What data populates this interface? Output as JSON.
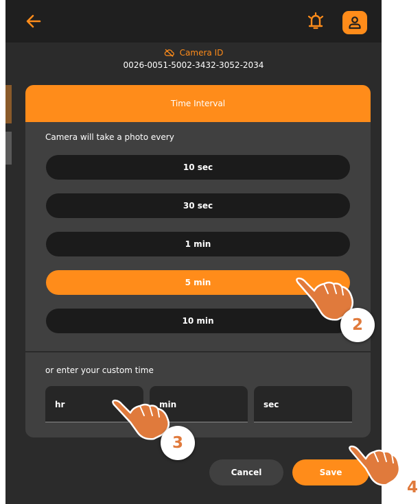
{
  "header": {
    "back_icon": "arrow-left-icon",
    "alarm_icon": "alarm-bell-icon",
    "profile_icon": "user-icon"
  },
  "camera": {
    "label": "Camera ID",
    "status_icon": "cloud-off-icon",
    "id": "0026-0051-5002-3432-3052-2034"
  },
  "dialog": {
    "title": "Time Interval",
    "prompt": "Camera will take a photo every",
    "options": [
      "10 sec",
      "30 sec",
      "1 min",
      "5 min",
      "10 min"
    ],
    "selected_option": "5 min",
    "custom_label": "or enter your custom time",
    "custom_fields": [
      {
        "placeholder": "hr",
        "value": ""
      },
      {
        "placeholder": "min",
        "value": ""
      },
      {
        "placeholder": "sec",
        "value": ""
      }
    ]
  },
  "actions": {
    "cancel_label": "Cancel",
    "save_label": "Save"
  },
  "annotations": {
    "step_2": "2",
    "step_3": "3",
    "step_4": "4"
  },
  "colors": {
    "accent": "#ff8c1a",
    "background": "#2b2b2b",
    "panel": "#404040",
    "option": "#1b1b1b",
    "annotation": "#e07a3c"
  }
}
